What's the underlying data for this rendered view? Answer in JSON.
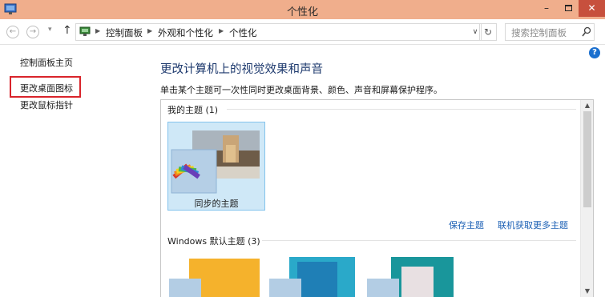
{
  "window": {
    "title": "个性化",
    "min_label": "–",
    "close_label": "✕"
  },
  "address": {
    "crumbs": [
      "控制面板",
      "外观和个性化",
      "个性化"
    ],
    "search_placeholder": "搜索控制面板"
  },
  "sidebar": {
    "items": [
      {
        "label": "控制面板主页"
      },
      {
        "label": "更改桌面图标",
        "highlighted": true
      },
      {
        "label": "更改鼠标指针"
      }
    ]
  },
  "main": {
    "title": "更改计算机上的视觉效果和声音",
    "description": "单击某个主题可一次性同时更改桌面背景、颜色、声音和屏幕保护程序。",
    "help_label": "?",
    "my_themes": {
      "header": "我的主题 (1)",
      "items": [
        {
          "name": "同步的主题",
          "selected": true
        }
      ]
    },
    "links": {
      "save": "保存主题",
      "online": "联机获取更多主题"
    },
    "default_themes": {
      "header": "Windows 默认主题 (3)"
    }
  },
  "colors": {
    "titlebar": "#f0ae8c",
    "close": "#c7503d",
    "link": "#1a5fb4",
    "highlight_box": "#d9242b",
    "selected_tile": "#cfe8f7"
  },
  "icons": [
    "control-panel-icon",
    "back-arrow-icon",
    "forward-arrow-icon",
    "up-arrow-icon",
    "refresh-icon",
    "search-icon",
    "help-icon"
  ]
}
